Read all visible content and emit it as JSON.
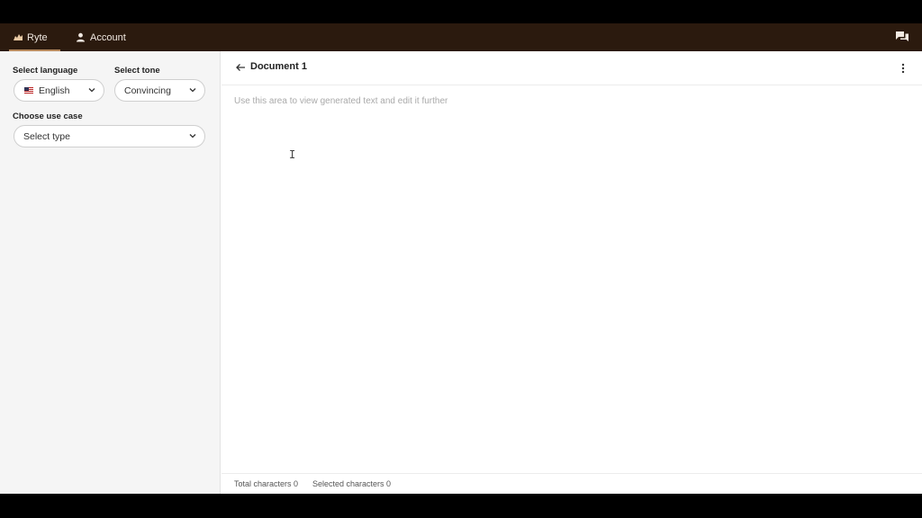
{
  "nav": {
    "brand_label": "Ryte",
    "account_label": "Account",
    "icons": [
      "ryte-logo-icon",
      "person-icon",
      "chat-bubbles-icon"
    ]
  },
  "sidebar": {
    "language": {
      "label": "Select language",
      "value": "English"
    },
    "tone": {
      "label": "Select tone",
      "value": "Convincing"
    },
    "use_case": {
      "label": "Choose use case",
      "placeholder": "Select type"
    }
  },
  "document": {
    "title": "Document 1",
    "editor_placeholder": "Use this area to view generated text and edit it further",
    "editor_value": ""
  },
  "footer": {
    "total_label": "Total characters",
    "total_value": "0",
    "selected_label": "Selected characters",
    "selected_value": "0"
  },
  "colors": {
    "topbar": "#2b1a0e",
    "accent": "#b88a5e",
    "sidebar_bg": "#f5f5f5"
  }
}
